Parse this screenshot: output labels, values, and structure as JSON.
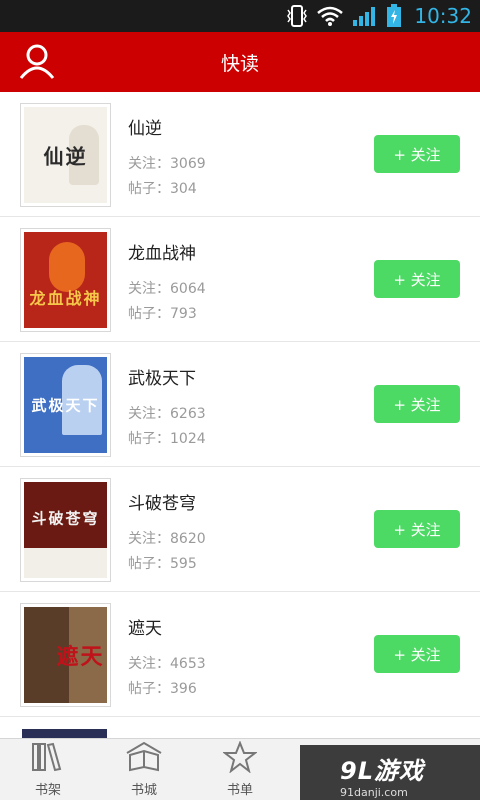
{
  "status_bar": {
    "time": "10:32"
  },
  "header": {
    "title": "快读"
  },
  "books": [
    {
      "title": "仙逆",
      "follow": "关注：3069",
      "posts": "帖子：304",
      "button": "+ 关注",
      "cover_text": "仙逆",
      "cover_bg": "#f4f1ea",
      "cover_fg": "#2b2b2b"
    },
    {
      "title": "龙血战神",
      "follow": "关注：6064",
      "posts": "帖子：793",
      "button": "+ 关注",
      "cover_text": "龙血战神",
      "cover_bg": "#b8261a",
      "cover_fg": "#f6c84a"
    },
    {
      "title": "武极天下",
      "follow": "关注：6263",
      "posts": "帖子：1024",
      "button": "+ 关注",
      "cover_text": "武极天下",
      "cover_bg": "#3f6fc3",
      "cover_fg": "#ffffff"
    },
    {
      "title": "斗破苍穹",
      "follow": "关注：8620",
      "posts": "帖子：595",
      "button": "+ 关注",
      "cover_text": "斗破苍穹",
      "cover_bg": "#6a1a12",
      "cover_fg": "#f2f2f2"
    },
    {
      "title": "遮天",
      "follow": "关注：4653",
      "posts": "帖子：396",
      "button": "+ 关注",
      "cover_text": "遮天",
      "cover_bg": "#8a6a48",
      "cover_fg": "#c0121a"
    }
  ],
  "tabs": [
    {
      "label": "书架",
      "icon": "bookshelf-icon"
    },
    {
      "label": "书城",
      "icon": "bookstore-icon"
    },
    {
      "label": "书单",
      "icon": "star-icon"
    }
  ],
  "watermark": {
    "logo": "9L游戏",
    "url": "91danji.com"
  },
  "colors": {
    "header": "#cc0000",
    "follow_button": "#4cd964",
    "status_time": "#33b5e5"
  }
}
